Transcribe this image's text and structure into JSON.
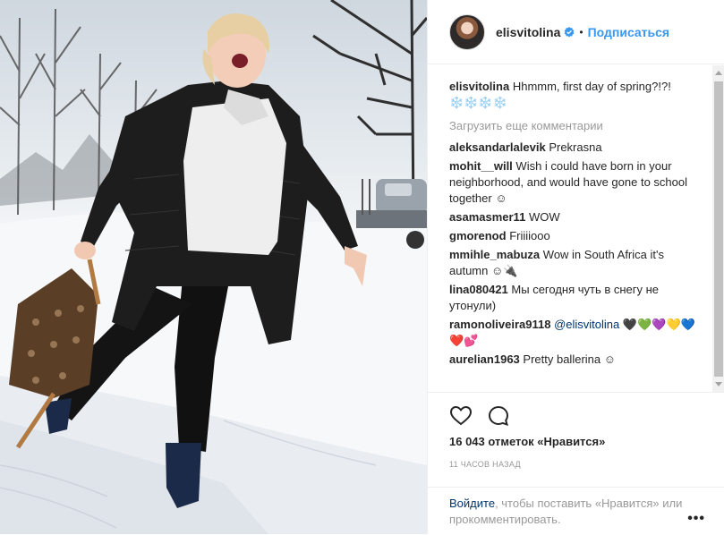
{
  "post": {
    "username": "elisvitolina",
    "follow_label": "Подписаться",
    "dot": "•",
    "caption_user": "elisvitolina",
    "caption_text": "Hhmmm, first day of spring?!?! ❄️❄️❄️❄️",
    "load_more": "Загрузить еще комментарии",
    "comments": [
      {
        "user": "aleksandarlalevik",
        "text": "Prekrasna"
      },
      {
        "user": "mohit__will",
        "text": "Wish i could have born in your neighborhood, and would have gone to school together ☺"
      },
      {
        "user": "asamasmer11",
        "text": "WOW"
      },
      {
        "user": "gmorenod",
        "text": "Friiiiooo"
      },
      {
        "user": "mmihle_mabuza",
        "text": "Wow in South Africa it's autumn ☺🔌"
      },
      {
        "user": "lina080421",
        "text": "Мы сегодня чуть в снегу не утонули)"
      },
      {
        "user": "ramonoliveira9118",
        "mention": "@elisvitolina",
        "text": "🖤💚💜💛💙❤️💕"
      },
      {
        "user": "aurelian1963",
        "text": "Pretty ballerina ☺"
      }
    ],
    "likes": "16 043 отметок «Нравится»",
    "time": "11 часов назад",
    "login_link": "Войдите",
    "login_text": ", чтобы поставить «Нравится» или прокомментировать.",
    "more": "•••"
  },
  "icons": {
    "verified": "verified-badge-icon",
    "like": "heart-icon",
    "comment": "comment-bubble-icon",
    "more": "more-options-icon"
  },
  "colors": {
    "link": "#3897f0",
    "username": "#262626",
    "muted": "#999999",
    "mention": "#003569"
  }
}
